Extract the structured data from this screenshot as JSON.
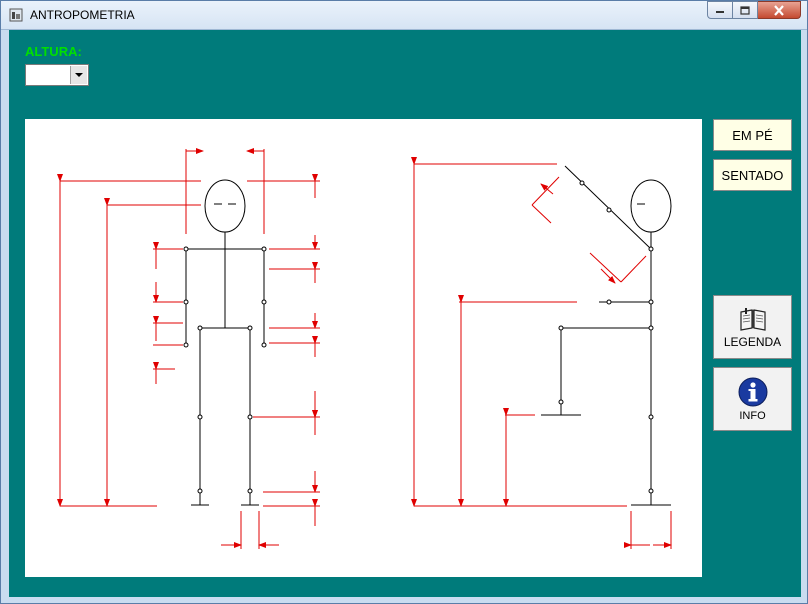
{
  "window": {
    "title": "ANTROPOMETRIA"
  },
  "altura": {
    "label": "ALTURA:",
    "value": ""
  },
  "buttons": {
    "em_pe": "EM PÉ",
    "sentado": "SENTADO",
    "legenda": "LEGENDA",
    "info": "INFO"
  },
  "icons": {
    "app": "app-icon",
    "legenda": "open-book-icon",
    "info": "info-icon"
  },
  "colors": {
    "client_bg": "#007b7b",
    "label_green": "#00e000",
    "dimension_red": "#e00000",
    "figure_black": "#000000",
    "info_blue": "#1a3aa0"
  }
}
